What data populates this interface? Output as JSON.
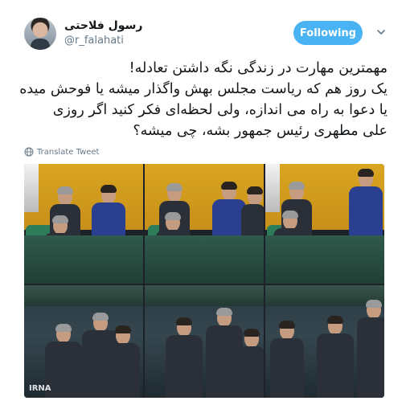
{
  "user": {
    "display_name": "رسول فلاحتی",
    "handle": "@r_falahati",
    "avatar_icon": "profile-photo"
  },
  "follow_button": {
    "label": "Following",
    "color": "#4ab3f4"
  },
  "more_menu": {
    "icon": "chevron-down-icon"
  },
  "tweet": {
    "lines": [
      "مهمترین مهارت در زندگی نگه داشتن تعادله!",
      "یک روز هم که ریاست مجلس بهش واگذار میشه یا فوحش میده",
      "یا دعوا به راه می اندازه، ولی لحظه‌ای فکر کنید اگر روزی",
      "علی مطهری رئیس جمهور بشه، چی میشه؟"
    ]
  },
  "translate": {
    "label": "Translate Tweet",
    "icon": "globe-icon"
  },
  "media": {
    "description_panels": 6,
    "watermark": "IRNA"
  }
}
